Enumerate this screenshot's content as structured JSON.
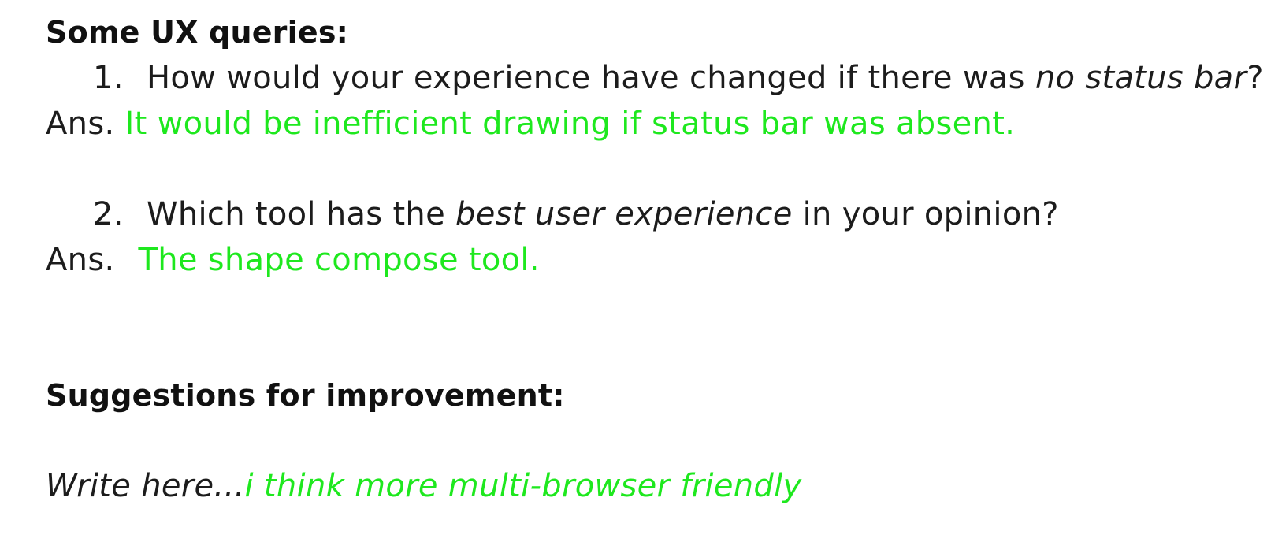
{
  "section1": {
    "heading": "Some UX queries:",
    "q1": {
      "number": "1.",
      "text_before": "How would your experience have changed if there was ",
      "text_emphasis": "no status bar",
      "text_after": "?",
      "ans_prefix": "Ans.",
      "answer": "It would be inefficient drawing if status bar was absent."
    },
    "q2": {
      "number": "2.",
      "text_before": "Which tool has the ",
      "text_emphasis": "best user experience",
      "text_after": " in your opinion?",
      "ans_prefix": "Ans.",
      "answer": "The shape compose tool."
    }
  },
  "section2": {
    "heading": "Suggestions for improvement:",
    "write_prefix": "Write here...",
    "write_answer": "i think more multi-browser friendly"
  },
  "colors": {
    "answer": "#1ee81e",
    "text": "#1c1c1c"
  }
}
